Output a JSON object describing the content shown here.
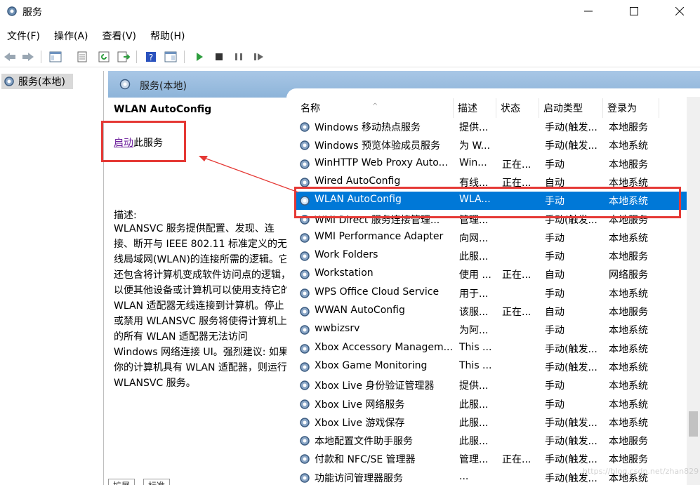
{
  "window": {
    "title": "服务"
  },
  "menu": [
    "文件(F)",
    "操作(A)",
    "查看(V)",
    "帮助(H)"
  ],
  "tree": {
    "item": "服务(本地)"
  },
  "pane": {
    "title": "服务(本地)"
  },
  "details": {
    "service_name": "WLAN AutoConfig",
    "start_link": "启动",
    "start_suffix": "此服务",
    "description_label": "描述:",
    "description": "WLANSVC 服务提供配置、发现、连接、断开与 IEEE 802.11 标准定义的无线局域网(WLAN)的连接所需的逻辑。它还包含将计算机变成软件访问点的逻辑，以便其他设备或计算机可以使用支持它的 WLAN 适配器无线连接到计算机。停止或禁用 WLANSVC 服务将使得计算机上的所有 WLAN 适配器无法访问 Windows 网络连接 UI。强烈建议: 如果你的计算机具有 WLAN 适配器，则运行 WLANSVC 服务。"
  },
  "columns": {
    "name": "名称",
    "desc": "描述",
    "state": "状态",
    "start": "启动类型",
    "logon": "登录为"
  },
  "rows": [
    {
      "name": "Windows 移动热点服务",
      "desc": "提供...",
      "state": "",
      "start": "手动(触发...",
      "logon": "本地服务"
    },
    {
      "name": "Windows 预览体验成员服务",
      "desc": "为 W...",
      "state": "",
      "start": "手动(触发...",
      "logon": "本地系统"
    },
    {
      "name": "WinHTTP Web Proxy Auto...",
      "desc": "Win...",
      "state": "正在...",
      "start": "手动",
      "logon": "本地服务"
    },
    {
      "name": "Wired AutoConfig",
      "desc": "有线...",
      "state": "正在...",
      "start": "自动",
      "logon": "本地系统"
    },
    {
      "name": "WLAN AutoConfig",
      "desc": "WLA...",
      "state": "",
      "start": "手动",
      "logon": "本地系统"
    },
    {
      "name": "WMI Direct 服务连接管理...",
      "desc": "管理...",
      "state": "",
      "start": "手动(触发...",
      "logon": "本地服务"
    },
    {
      "name": "WMI Performance Adapter",
      "desc": "向网...",
      "state": "",
      "start": "手动",
      "logon": "本地系统"
    },
    {
      "name": "Work Folders",
      "desc": "此服...",
      "state": "",
      "start": "手动",
      "logon": "本地服务"
    },
    {
      "name": "Workstation",
      "desc": "使用 ...",
      "state": "正在...",
      "start": "自动",
      "logon": "网络服务"
    },
    {
      "name": "WPS Office Cloud Service",
      "desc": "用于...",
      "state": "",
      "start": "手动",
      "logon": "本地系统"
    },
    {
      "name": "WWAN AutoConfig",
      "desc": "该服...",
      "state": "正在...",
      "start": "自动",
      "logon": "本地服务"
    },
    {
      "name": "wwbizsrv",
      "desc": "为阿...",
      "state": "",
      "start": "手动",
      "logon": "本地系统"
    },
    {
      "name": "Xbox Accessory Managem...",
      "desc": "This ...",
      "state": "",
      "start": "手动(触发...",
      "logon": "本地系统"
    },
    {
      "name": "Xbox Game Monitoring",
      "desc": "This ...",
      "state": "",
      "start": "手动(触发...",
      "logon": "本地系统"
    },
    {
      "name": "Xbox Live 身份验证管理器",
      "desc": "提供...",
      "state": "",
      "start": "手动",
      "logon": "本地系统"
    },
    {
      "name": "Xbox Live 网络服务",
      "desc": "此服...",
      "state": "",
      "start": "手动",
      "logon": "本地系统"
    },
    {
      "name": "Xbox Live 游戏保存",
      "desc": "此服...",
      "state": "",
      "start": "手动(触发...",
      "logon": "本地系统"
    },
    {
      "name": "本地配置文件助手服务",
      "desc": "此服...",
      "state": "",
      "start": "手动(触发...",
      "logon": "本地服务"
    },
    {
      "name": "付款和 NFC/SE 管理器",
      "desc": "管理...",
      "state": "正在...",
      "start": "手动(触发...",
      "logon": "本地服务"
    },
    {
      "name": "功能访问管理器服务",
      "desc": "...",
      "state": "",
      "start": "手动(触发...",
      "logon": "本地系统"
    }
  ],
  "selected_index": 4,
  "tabs": [
    "扩展",
    "标准"
  ],
  "watermark": "https://blog.csdn.net/zhan829",
  "colors": {
    "selection": "#0078d7",
    "header": "#8db4d9",
    "highlight_box": "#e53935",
    "link": "#6a1b9a"
  }
}
